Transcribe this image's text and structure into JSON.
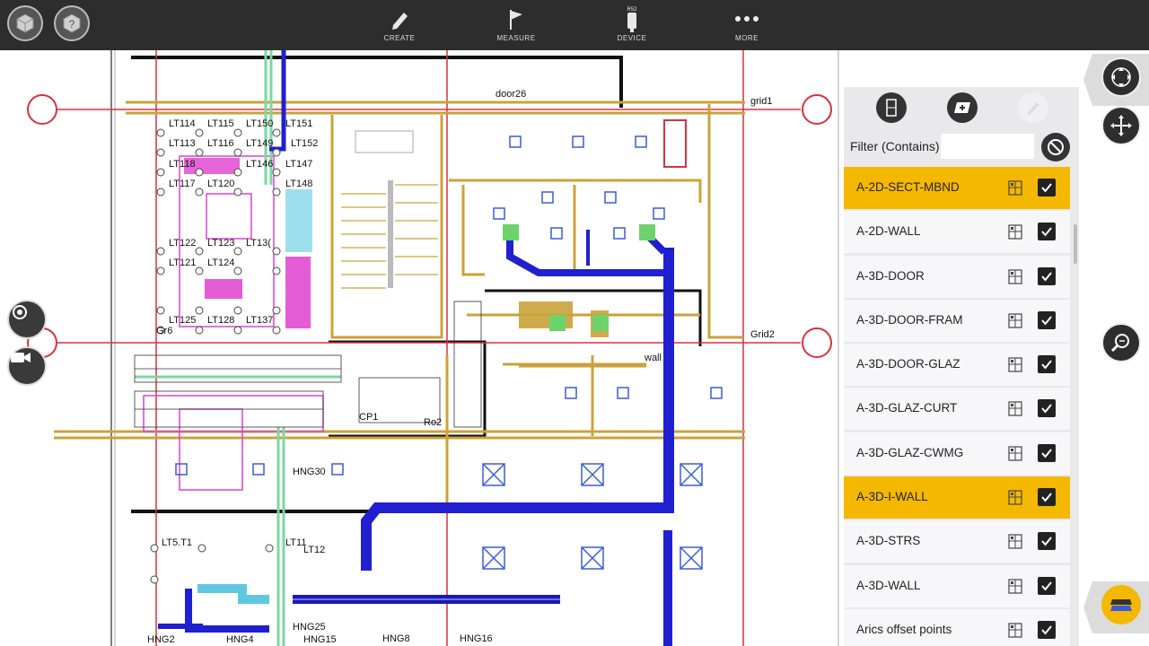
{
  "toolbar": {
    "left_buttons": [
      {
        "icon": "cube-view-icon"
      },
      {
        "icon": "cube-help-icon"
      }
    ],
    "tools": [
      {
        "label": "CREATE",
        "icon": "pencil-icon"
      },
      {
        "label": "MEASURE",
        "icon": "flag-icon"
      },
      {
        "label": "DEVICE",
        "icon": "device-icon",
        "badge": "R52"
      },
      {
        "label": "MORE",
        "icon": "more-icon"
      }
    ]
  },
  "drawing": {
    "labels": {
      "lt114": "LT114",
      "lt115": "LT115",
      "lt150": "LT150",
      "lt151": "LT151",
      "lt113": "LT113",
      "lt116": "LT116",
      "lt149": "LT149",
      "lt152": "LT152",
      "lt118": "LT118",
      "lt146": "LT146",
      "lt147": "LT147",
      "lt117": "LT117",
      "lt120": "LT120",
      "lt148": "LT148",
      "lt122": "LT122",
      "lt123": "LT123",
      "lt13x": "LT13(",
      "lt121": "LT121",
      "lt124": "LT124",
      "lt125": "LT125",
      "lt128": "LT128",
      "lt137": "LT137",
      "door26": "door26",
      "grid1": "grid1",
      "grid2": "Grid2",
      "wall": "wall",
      "cp1": "CP1",
      "ro2": "Ro2",
      "hng2": "HNG2",
      "hng4": "HNG4",
      "hng8": "HNG8",
      "hng16": "HNG16",
      "hng25": "HNG25",
      "hng30": "HNG30",
      "hng15": "HNG15",
      "lt5t1": "LT5.T1",
      "lt11": "LT11",
      "lt12": "LT12",
      "gr6": "Gr6"
    }
  },
  "layer_panel": {
    "tool_icons": [
      "layer-view-icon",
      "layer-add-icon",
      "layer-edit-icon"
    ],
    "filter_label": "Filter (Contains)",
    "filter_value": "",
    "filter_placeholder": "",
    "layers": [
      {
        "name": "A-2D-SECT-MBND",
        "highlighted": true,
        "checked": true
      },
      {
        "name": "A-2D-WALL",
        "highlighted": false,
        "checked": true
      },
      {
        "name": "A-3D-DOOR",
        "highlighted": false,
        "checked": true
      },
      {
        "name": "A-3D-DOOR-FRAM",
        "highlighted": false,
        "checked": true
      },
      {
        "name": "A-3D-DOOR-GLAZ",
        "highlighted": false,
        "checked": true
      },
      {
        "name": "A-3D-GLAZ-CURT",
        "highlighted": false,
        "checked": true
      },
      {
        "name": "A-3D-GLAZ-CWMG",
        "highlighted": false,
        "checked": true
      },
      {
        "name": "A-3D-I-WALL",
        "highlighted": true,
        "checked": true
      },
      {
        "name": "A-3D-STRS",
        "highlighted": false,
        "checked": true
      },
      {
        "name": "A-3D-WALL",
        "highlighted": false,
        "checked": true
      },
      {
        "name": "Arics offset points",
        "highlighted": false,
        "checked": true
      }
    ]
  },
  "colors": {
    "highlight": "#f5b800",
    "topbar": "#2d2d2d",
    "grid_red": "#d8313d",
    "duct_blue": "#2020d0",
    "wall_gold": "#c9a33a",
    "magenta": "#e040d0",
    "pipe_green": "#7ad8a0"
  }
}
